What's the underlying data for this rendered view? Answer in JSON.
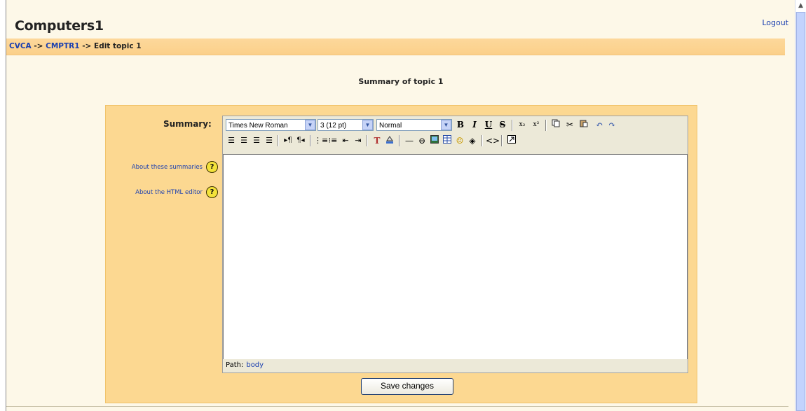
{
  "header": {
    "title": "Computers1",
    "logout": "Logout"
  },
  "breadcrumb": {
    "items": [
      "CVCA",
      "CMPTR1"
    ],
    "separator": "->",
    "current": "Edit topic 1"
  },
  "page": {
    "heading": "Summary of topic 1"
  },
  "form": {
    "summary_label": "Summary:",
    "help_links": [
      {
        "label": "About these summaries",
        "icon": "help-icon"
      },
      {
        "label": "About the HTML editor",
        "icon": "help-icon"
      }
    ],
    "editor": {
      "font_family": "Times New Roman",
      "font_size": "3 (12 pt)",
      "format": "Normal",
      "path_label": "Path:",
      "path_value": "body"
    },
    "save_label": "Save changes"
  },
  "colors": {
    "page_bg": "#fdf8e8",
    "navbar": "#fbd08a",
    "box": "#fcd891",
    "link": "#1a3fb0"
  }
}
